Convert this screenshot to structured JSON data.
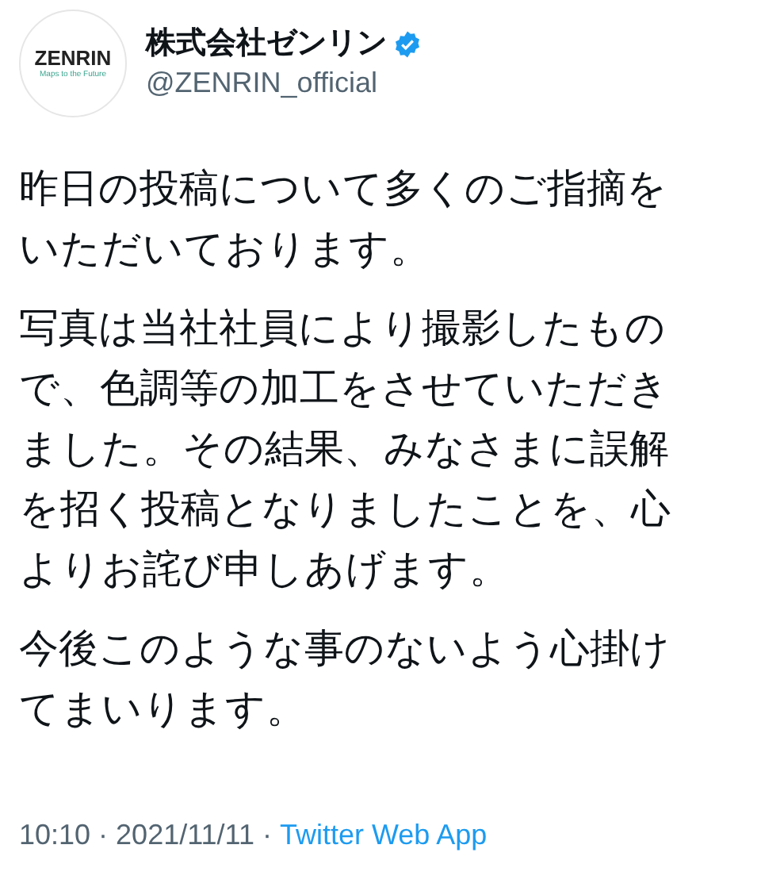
{
  "author": {
    "avatar_logo": "ZENRIN",
    "avatar_tagline": "Maps to the Future",
    "name": "株式会社ゼンリン",
    "verified": true,
    "handle": "@ZENRIN_official"
  },
  "paragraphs": [
    [
      "昨日の投稿について多くのご指摘を",
      "いただいております。"
    ],
    [
      "写真は当社社員により撮影したもの",
      "で、色調等の加工をさせていただき",
      "ました。その結果、みなさまに誤解",
      "を招く投稿となりましたことを、心",
      "よりお詫び申しあげます。"
    ],
    [
      "今後このような事のないよう心掛け",
      "てまいります。"
    ]
  ],
  "footer": {
    "time": "10:10",
    "separator_1": "·",
    "date": "2021/11/11",
    "separator_2": "·",
    "source": "Twitter Web App"
  }
}
